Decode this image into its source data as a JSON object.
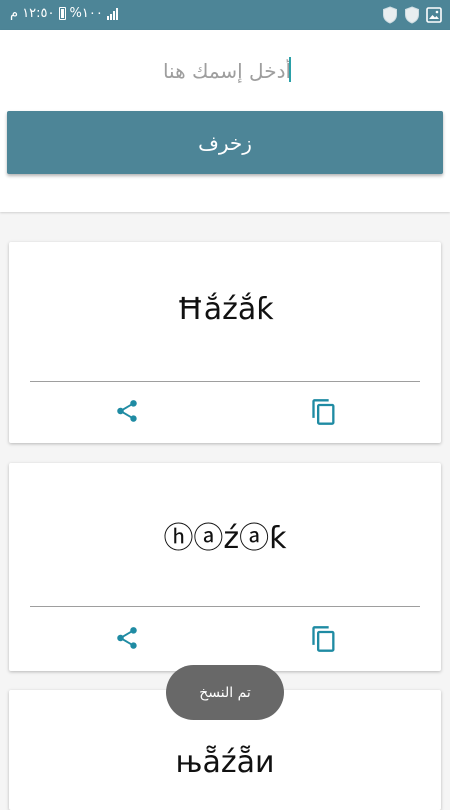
{
  "status_bar": {
    "time": "١٢:٥٠ م",
    "battery_percent": "%١٠٠",
    "network": "Ill.",
    "icons": [
      "shield-icon",
      "shield-icon",
      "image-icon"
    ]
  },
  "input": {
    "placeholder": "أدخل إسمك هنا",
    "value": ""
  },
  "decorate_button": {
    "label": "زخرف"
  },
  "cards": [
    {
      "text": "Ħắźắƙ",
      "share_icon": "share-icon",
      "copy_icon": "copy-icon"
    },
    {
      "text": "ⓗⓐźⓐƙ",
      "share_icon": "share-icon",
      "copy_icon": "copy-icon"
    },
    {
      "text": "њẵźẵи"
    }
  ],
  "toast": {
    "message": "تم النسخ"
  },
  "colors": {
    "primary": "#4d8597",
    "icon_teal": "#1f8ba3",
    "toast_bg": "#686868"
  }
}
